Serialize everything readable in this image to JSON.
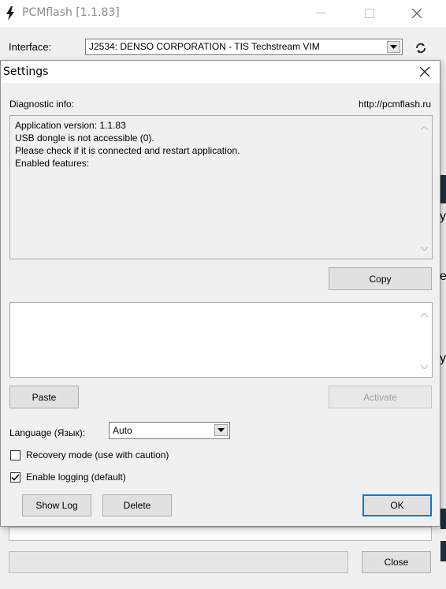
{
  "main_window": {
    "title": "PCMflash [1.1.83]",
    "interface_label": "Interface:",
    "interface_value": "J2534: DENSO CORPORATION - TIS Techstream VIM",
    "close_label": "Close",
    "bg_chars": [
      "y",
      "e",
      "y"
    ]
  },
  "settings": {
    "title": "Settings",
    "diagnostic_label": "Diagnostic info:",
    "url": "http://pcmflash.ru",
    "diagnostic_lines": [
      "Application version: 1.1.83",
      "USB dongle is not accessible (0).",
      "Please check if it is connected and restart application.",
      "Enabled features:"
    ],
    "copy_label": "Copy",
    "paste_label": "Paste",
    "activate_label": "Activate",
    "language_label": "Language (Язык):",
    "language_value": "Auto",
    "recovery_label": "Recovery mode (use with caution)",
    "recovery_checked": false,
    "logging_label": "Enable logging (default)",
    "logging_checked": true,
    "showlog_label": "Show Log",
    "delete_label": "Delete",
    "ok_label": "OK"
  },
  "colors": {
    "accent": "#0078d7",
    "dialog_bg": "#f0f0f0"
  }
}
